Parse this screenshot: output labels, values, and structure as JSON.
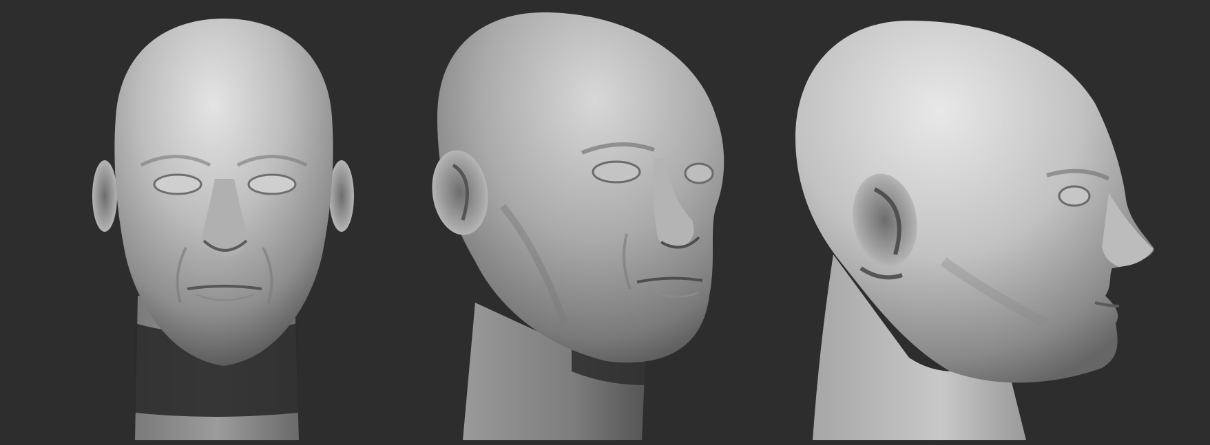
{
  "scene": {
    "background_color": "#2d2d2d",
    "material_color": "#b4b4b4",
    "shadow_color": "#2a2a2a",
    "views": [
      {
        "name": "front-view",
        "subject": "head-sculpt-front"
      },
      {
        "name": "three-quarter-view",
        "subject": "head-sculpt-three-quarter"
      },
      {
        "name": "profile-view",
        "subject": "head-sculpt-profile"
      }
    ]
  }
}
